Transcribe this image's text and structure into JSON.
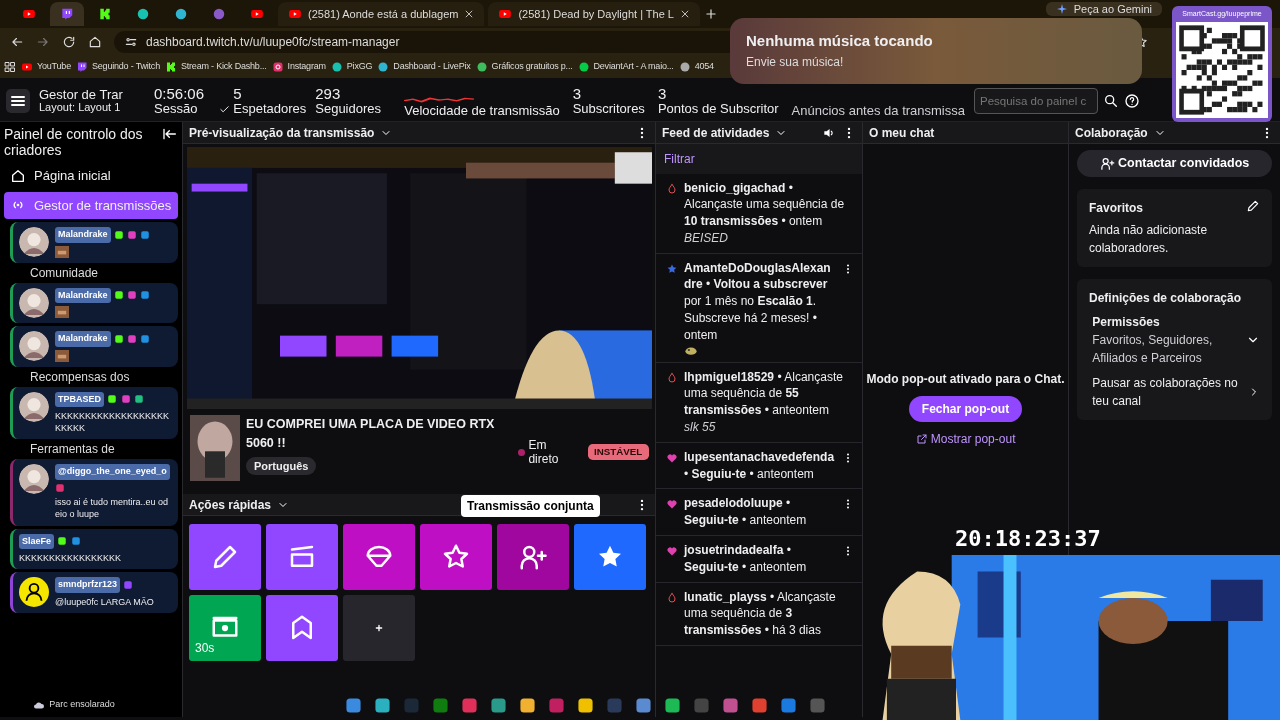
{
  "browser": {
    "tabs": [
      {
        "kind": "youtube",
        "selected": false
      },
      {
        "kind": "twitch",
        "selected": true
      },
      {
        "kind": "kick",
        "selected": false
      },
      {
        "kind": "pixgg",
        "selected": false
      },
      {
        "kind": "livepix",
        "selected": false
      },
      {
        "kind": "creature",
        "selected": false
      },
      {
        "kind": "youtube",
        "selected": false
      },
      {
        "kind": "youtube",
        "title": "(2581) Aonde está a dublagem",
        "selected": false
      },
      {
        "kind": "youtube",
        "title": "(2581) Dead by Daylight | The L",
        "selected": false
      }
    ],
    "gemini": "Peça ao Gemini",
    "url": "dashboard.twitch.tv/u/luupe0fc/stream-manager",
    "bookmarks": [
      {
        "kind": "youtube",
        "label": "YouTube"
      },
      {
        "kind": "twitch",
        "label": "Seguindo - Twitch"
      },
      {
        "kind": "kick",
        "label": "Stream - Kick Dashb..."
      },
      {
        "kind": "instagram",
        "label": "Instagram"
      },
      {
        "kind": "pixgg",
        "label": "PixGG"
      },
      {
        "kind": "livepix",
        "label": "Dashboard - LivePix"
      },
      {
        "kind": "freepik",
        "label": "Gráficos gratuitos p..."
      },
      {
        "kind": "deviantart",
        "label": "DeviantArt - A maio..."
      },
      {
        "kind": "other",
        "label": "4054"
      }
    ]
  },
  "music": {
    "title": "Nenhuma música tocando",
    "subtitle": "Envie sua música!"
  },
  "qr": {
    "caption": "SmartCast.gg/luupeprime"
  },
  "header": {
    "title": "Gestor de Trar",
    "layout": "Layout: Layout 1",
    "stats": [
      {
        "kind": "session",
        "value": "0:56:06",
        "label": "Sessão"
      },
      {
        "kind": "viewers",
        "value": "5",
        "label": "Espetadores"
      },
      {
        "kind": "followers",
        "value": "293",
        "label": "Seguidores"
      },
      {
        "kind": "speed",
        "label": "Velocidade de transmissão"
      },
      {
        "kind": "subs",
        "value": "3",
        "label": "Subscritores"
      },
      {
        "kind": "points",
        "value": "3",
        "label": "Pontos de Subscritor"
      },
      {
        "kind": "ads",
        "label": "Anúncios antes da transmissa"
      }
    ],
    "search": {
      "placeholder": "Pesquisa do painel c"
    }
  },
  "sidebar": {
    "title": "Painel de controlo dos criadores",
    "items": [
      {
        "kind": "home",
        "label": "Página inicial",
        "selected": false
      },
      {
        "kind": "manager",
        "label": "Gestor de transmissões",
        "selected": true
      },
      {
        "kind": "chat",
        "user": "Malandrake",
        "avatar": {
          "kind": "picture"
        },
        "badges": [
          {
            "color": "#53fc18"
          },
          {
            "color": "#e040c0"
          },
          {
            "color": "#2090e0"
          }
        ],
        "emote": true,
        "color": "#1f9d55"
      },
      {
        "kind": "section",
        "label": "Comunidade"
      },
      {
        "kind": "chat",
        "user": "Malandrake",
        "avatar": {
          "kind": "picture"
        },
        "badges": [
          {
            "color": "#53fc18"
          },
          {
            "color": "#e040c0"
          },
          {
            "color": "#2090e0"
          }
        ],
        "emote": true,
        "color": "#1f9d55"
      },
      {
        "kind": "chat",
        "user": "Malandrake",
        "avatar": {
          "kind": "picture"
        },
        "badges": [
          {
            "color": "#53fc18"
          },
          {
            "color": "#e040c0"
          },
          {
            "color": "#2090e0"
          }
        ],
        "emote": true,
        "color": "#1f9d55"
      },
      {
        "kind": "section",
        "label": "Recompensas dos"
      },
      {
        "kind": "chat",
        "user": "TPBASED",
        "avatar": {
          "kind": "picture"
        },
        "badges": [
          {
            "color": "#53fc18"
          },
          {
            "color": "#e040c0"
          },
          {
            "color": "#20c080"
          }
        ],
        "message": "KKKKKKKKKKKKKKKKKKKKKKKK",
        "color": "#1f9d55"
      },
      {
        "kind": "section",
        "label": "Ferramentas de"
      },
      {
        "kind": "chat",
        "user": "@diggo_the_one_eyed_o",
        "avatar": {
          "kind": "picture"
        },
        "badges": [
          {
            "color": "#e03070"
          }
        ],
        "message": "isso ai é tudo mentira..eu odeio o luupe",
        "color": "#8a2a6a"
      },
      {
        "kind": "chat",
        "user": "SlaeFe",
        "badges": [
          {
            "color": "#53fc18"
          },
          {
            "color": "#2090e0"
          }
        ],
        "message": "KKKKKKKKKKKKKKKKK",
        "color": "#1f9d55"
      },
      {
        "kind": "chat",
        "user": "smndprfzr123",
        "avatar": {
          "kind": "silhouette"
        },
        "badges": [
          {
            "color": "#9146ff"
          }
        ],
        "message": "@luupe0fc LARGA MÃO",
        "color": "#8e44d6"
      }
    ]
  },
  "preview": {
    "title": "Pré-visualização da transmissão",
    "stream": {
      "title": "EU COMPREI UMA PLACA DE VIDEO RTX 5060 !!",
      "tag": "Português",
      "status": "Em direto",
      "health": "INSTÁVEL"
    }
  },
  "quick_actions": {
    "title": "Ações rápidas",
    "tooltip": "Transmissão conjunta",
    "tiles": [
      {
        "kind": "pencil",
        "color": "#9146ff"
      },
      {
        "kind": "clapper",
        "color": "#9146ff"
      },
      {
        "kind": "parachute",
        "color": "#bf0fc4"
      },
      {
        "kind": "star",
        "color": "#bf0fc4"
      },
      {
        "kind": "person-plus",
        "color": "#a0079f"
      },
      {
        "kind": "star-filled",
        "color": "#1f69ff"
      },
      {
        "kind": "money",
        "color": "#00a651",
        "label": "30s"
      },
      {
        "kind": "chevron",
        "color": "#9146ff"
      },
      {
        "kind": "plus",
        "color": "#26262c"
      }
    ]
  },
  "activity": {
    "title": "Feed de atividades",
    "filter": "Filtrar",
    "items": [
      {
        "kind": "streak",
        "user": "benicio_gigachad",
        "text": "• Alcançaste uma sequência de **10 transmissões** • ontem",
        "note": "BEISED"
      },
      {
        "kind": "sub",
        "user": "AmanteDoDouglasAlexandre",
        "text": "• **Voltou a subscrever** por 1 mês no **Escalão 1**. Subscreve há 2 meses! • ontem",
        "emote": true
      },
      {
        "kind": "streak",
        "user": "lhpmiguel18529",
        "text": "• Alcançaste uma sequência de **55 transmissões** • anteontem",
        "note": "slk 55"
      },
      {
        "kind": "follow",
        "user": "lupesentanachavedefenda",
        "text": "• **Seguiu-te** • anteontem"
      },
      {
        "kind": "follow",
        "user": "pesadelodoluupe",
        "text": "• **Seguiu-te** • anteontem"
      },
      {
        "kind": "follow",
        "user": "josuetrindadealfa",
        "text": "• **Seguiu-te** • anteontem"
      },
      {
        "kind": "streak",
        "user": "lunatic_playss",
        "text": "• Alcançaste uma sequência de **3 transmissões** • há 3 dias"
      }
    ]
  },
  "chat": {
    "title": "O meu chat",
    "message": "Modo pop-out ativado para o Chat.",
    "close_button": "Fechar pop-out",
    "show_link": "Mostrar pop-out"
  },
  "collaboration": {
    "title": "Colaboração",
    "contact_button": "Contactar convidados",
    "favorites": {
      "title": "Favoritos",
      "text": "Ainda não adicionaste colaboradores."
    },
    "settings": {
      "title": "Definições de colaboração",
      "permissions_title": "Permissões",
      "permissions_value": "Favoritos, Seguidores, Afiliados e Parceiros",
      "pause": "Pausar as colaborações no teu canal"
    }
  },
  "overlay": {
    "clock": "20:18:23:37",
    "weather": "Parc ensolarado"
  }
}
